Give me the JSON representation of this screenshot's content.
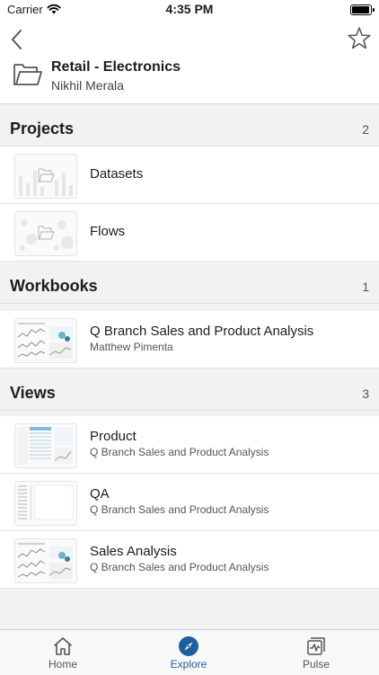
{
  "status_bar": {
    "carrier": "Carrier",
    "time": "4:35 PM",
    "battery_level": 0.95
  },
  "header": {
    "title": "Retail - Electronics",
    "owner": "Nikhil Merala"
  },
  "projects": {
    "label": "Projects",
    "count": "2",
    "items": [
      {
        "title": "Datasets"
      },
      {
        "title": "Flows"
      }
    ]
  },
  "workbooks": {
    "label": "Workbooks",
    "count": "1",
    "items": [
      {
        "title": "Q Branch Sales and Product Analysis",
        "subtitle": "Matthew Pimenta"
      }
    ]
  },
  "views": {
    "label": "Views",
    "count": "3",
    "items": [
      {
        "title": "Product",
        "subtitle": "Q Branch Sales and Product Analysis"
      },
      {
        "title": "QA",
        "subtitle": "Q Branch Sales and Product Analysis"
      },
      {
        "title": "Sales Analysis",
        "subtitle": "Q Branch Sales and Product Analysis"
      }
    ]
  },
  "tabbar": {
    "home": "Home",
    "explore": "Explore",
    "pulse": "Pulse",
    "active_color": "#1f5f9e"
  },
  "icons": [
    "back-chevron-icon",
    "favorite-star-icon",
    "folder-icon",
    "home-icon",
    "explore-compass-icon",
    "pulse-icon",
    "wifi-icon",
    "battery-icon"
  ]
}
